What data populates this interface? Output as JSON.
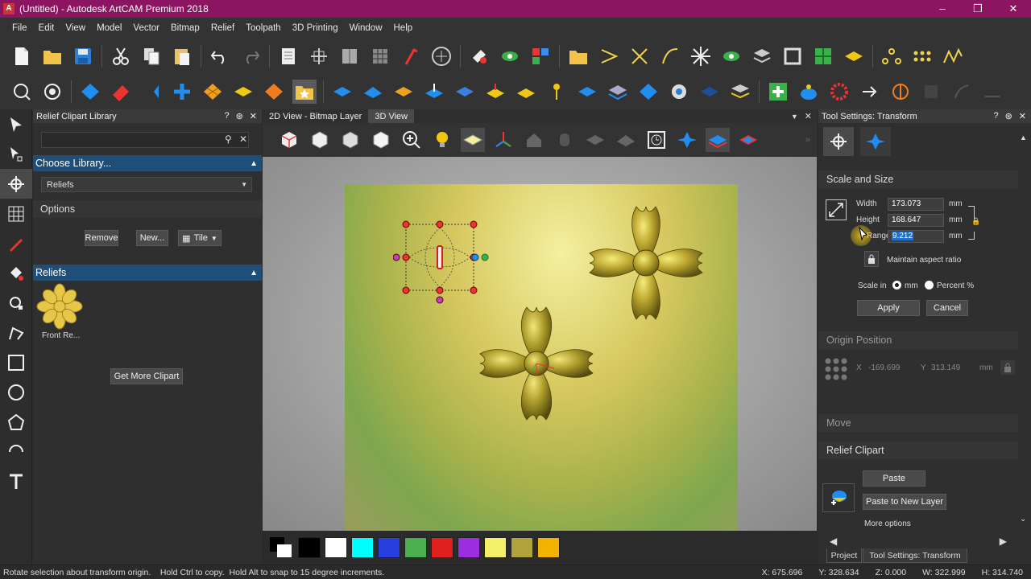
{
  "window": {
    "title": "(Untitled) - Autodesk ArtCAM Premium 2018",
    "logo": "A"
  },
  "menu": [
    "File",
    "Edit",
    "View",
    "Model",
    "Vector",
    "Bitmap",
    "Relief",
    "Toolpath",
    "3D Printing",
    "Window",
    "Help"
  ],
  "left_panel": {
    "title": "Relief Clipart Library",
    "search_placeholder": "",
    "choose_library_label": "Choose Library...",
    "library_selected": "Reliefs",
    "options_label": "Options",
    "remove_label": "Remove",
    "new_label": "New...",
    "tile_label": "Tile",
    "reliefs_section": "Reliefs",
    "thumbnail_label": "Front Re...",
    "get_more_label": "Get More Clipart"
  },
  "view_tabs": [
    {
      "label": "2D View - Bitmap Layer"
    },
    {
      "label": "3D View"
    }
  ],
  "palette": [
    "#000000",
    "#ffffff",
    "#00ffff",
    "#2a3fe0",
    "#4caf50",
    "#e01f1f",
    "#9b2fe0",
    "#f5f06a",
    "#b1a33c",
    "#f0b400"
  ],
  "right_panel": {
    "title": "Tool Settings: Transform",
    "scale_section": "Scale and Size",
    "width_label": "Width",
    "width_value": "173.073",
    "height_label": "Height",
    "height_value": "168.647",
    "range_label": "Range",
    "range_value": "9.212",
    "unit": "mm",
    "maintain_label": "Maintain aspect ratio",
    "scale_in_label": "Scale in",
    "scale_mm": "mm",
    "scale_percent": "Percent %",
    "apply_label": "Apply",
    "cancel_label": "Cancel",
    "origin_section": "Origin Position",
    "origin_x_label": "X",
    "origin_x_value": "-169.699",
    "origin_y_label": "Y",
    "origin_y_value": "313.149",
    "move_section": "Move",
    "clipart_section": "Relief Clipart",
    "paste_label": "Paste",
    "paste_new_label": "Paste to New Layer",
    "more_options_label": "More options",
    "bottom_tabs": [
      "Project",
      "Tool Settings: Transform"
    ]
  },
  "status": {
    "message": "Rotate selection about transform origin.    Hold Ctrl to copy.  Hold Alt to snap to 15 degree increments.",
    "x": "X: 675.696",
    "y": "Y: 328.634",
    "z": "Z: 0.000",
    "w": "W: 322.999",
    "h": "H: 314.740"
  }
}
